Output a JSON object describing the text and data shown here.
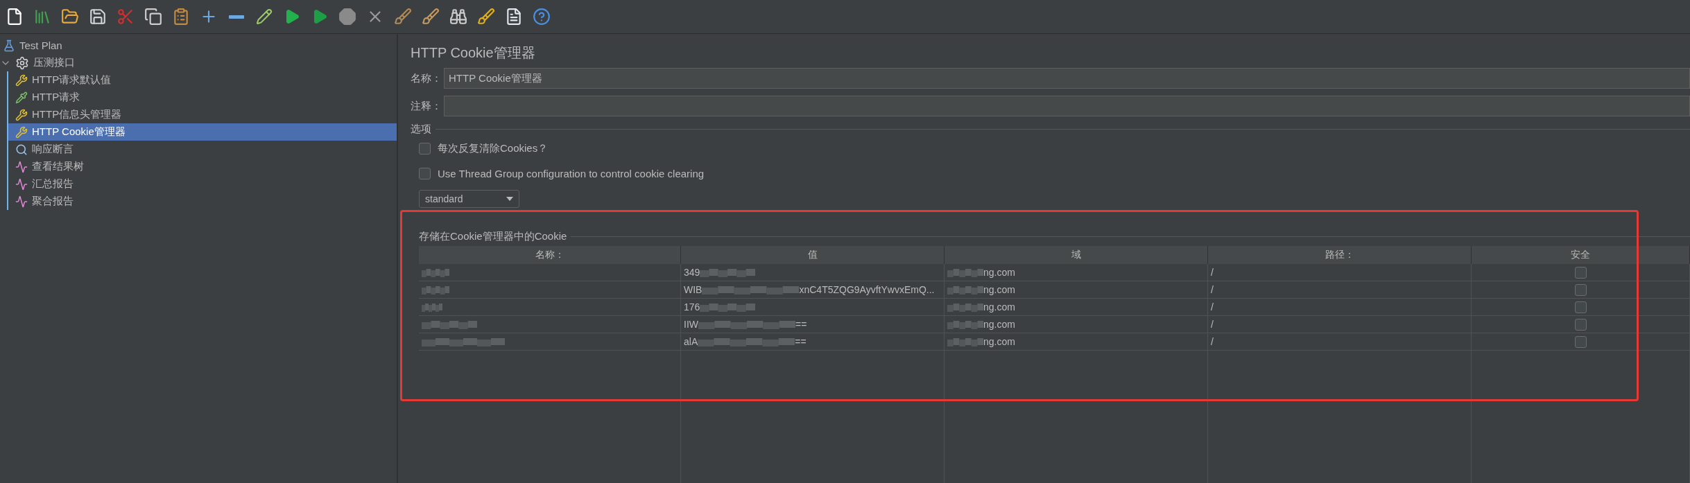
{
  "toolbar": {
    "buttons": [
      {
        "kind": "new"
      },
      {
        "kind": "templates"
      },
      {
        "kind": "open"
      },
      {
        "kind": "save"
      },
      {
        "kind": "cut"
      },
      {
        "kind": "copy"
      },
      {
        "kind": "paste"
      },
      {
        "kind": "expand"
      },
      {
        "kind": "collapse"
      },
      {
        "kind": "toggle"
      },
      {
        "kind": "start"
      },
      {
        "kind": "start_no_pause"
      },
      {
        "kind": "stop"
      },
      {
        "kind": "shutdown"
      },
      {
        "kind": "clear"
      },
      {
        "kind": "clear_all"
      },
      {
        "kind": "search"
      },
      {
        "kind": "reset_search"
      },
      {
        "kind": "function_helper"
      },
      {
        "kind": "help"
      }
    ]
  },
  "tree": {
    "label": "Test Plan",
    "kind": "plan",
    "children": [
      {
        "label": "压测接口",
        "kind": "thread_group",
        "expanded": true,
        "selected": false,
        "children": [
          {
            "label": "HTTP请求默认值",
            "kind": "config",
            "selected": false
          },
          {
            "label": "HTTP请求",
            "kind": "sampler",
            "selected": false
          },
          {
            "label": "HTTP信息头管理器",
            "kind": "config",
            "selected": false
          },
          {
            "label": "HTTP Cookie管理器",
            "kind": "config",
            "selected": true
          },
          {
            "label": "响应断言",
            "kind": "assertion",
            "selected": false
          },
          {
            "label": "查看结果树",
            "kind": "listener",
            "selected": false
          },
          {
            "label": "汇总报告",
            "kind": "listener",
            "selected": false
          },
          {
            "label": "聚合报告",
            "kind": "listener",
            "selected": false
          }
        ]
      }
    ]
  },
  "panel": {
    "title": "HTTP Cookie管理器",
    "name_label": "名称：",
    "name_value": "HTTP Cookie管理器",
    "comment_label": "注释：",
    "options_title": "选项",
    "options": [
      {
        "label": "每次反复清除Cookies？",
        "checked": false
      },
      {
        "label": "Use Thread Group configuration to control cookie clearing",
        "checked": false
      }
    ],
    "policy": {
      "value": "standard"
    },
    "cookies": {
      "title": "存储在Cookie管理器中的Cookie",
      "columns": [
        "名称：",
        "值",
        "域",
        "路径：",
        "安全"
      ],
      "rows": [
        {
          "value_start": "349",
          "value_end": "",
          "domain_end": "ng.com",
          "path": "/",
          "secure": false
        },
        {
          "value_start": "WIB",
          "value_end": "xnC4T5ZQG9AyvftYwvxEmQ...",
          "domain_end": "ng.com",
          "path": "/",
          "secure": false
        },
        {
          "value_start": "176",
          "value_end": "",
          "domain_end": "ng.com",
          "path": "/",
          "secure": false
        },
        {
          "value_start": "IIW",
          "value_end": "==",
          "domain_end": "ng.com",
          "path": "/",
          "secure": false
        },
        {
          "value_start": "alA",
          "value_end": "==",
          "domain_end": "ng.com",
          "path": "/",
          "secure": false
        }
      ]
    }
  }
}
